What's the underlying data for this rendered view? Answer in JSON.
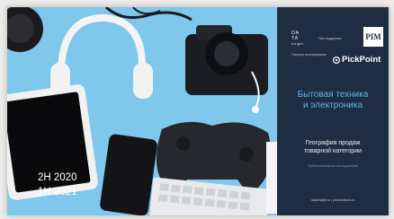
{
  "logo_data": {
    "line1": "DA",
    "line2": "TA",
    "line3": "insight"
  },
  "support_label": "При поддержке",
  "pim_logo": "PIM",
  "partner_label": "Партнер исследования",
  "pickpoint_logo": "PickPoint",
  "title": {
    "line1": "Бытовая техника",
    "line2": "и электроника"
  },
  "subtitle": {
    "line1": "География продаж",
    "line2": "товарной категории"
  },
  "public_version": "Публичная версия исследования",
  "sites": "datainsight.ru  |  pimsolutions.ru",
  "period": {
    "line1": "2H 2020",
    "line2": "1H 2021"
  },
  "colors": {
    "panel": "#1e2d42",
    "title": "#5fb6e8",
    "photo_bg": "#7fc6ec"
  }
}
